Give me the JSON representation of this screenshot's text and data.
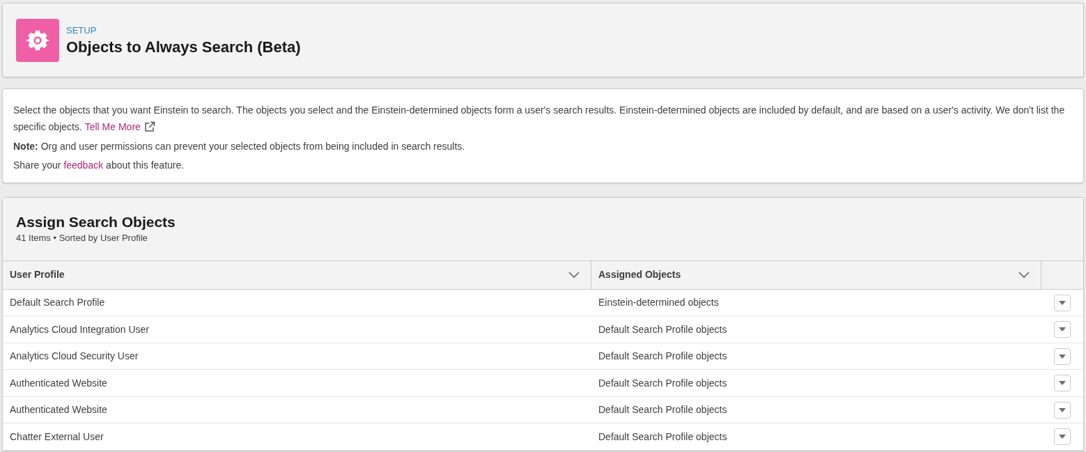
{
  "header": {
    "breadcrumb": "SETUP",
    "title": "Objects to Always Search (Beta)"
  },
  "description": {
    "intro": {
      "text": "Select the objects that you want Einstein to search. The objects you select and the Einstein-determined objects form a user's search results. Einstein-determined objects are included by default, and are based on a user's activity. We don't list the specific objects.",
      "link": "Tell Me More"
    },
    "note": "**Note:** Org and user permissions can prevent your selected objects from being included in search results.",
    "feedback": {
      "before": "Share your",
      "link": "feedback",
      "after": "about this feature."
    }
  },
  "table": {
    "title": "Assign Search Objects",
    "subtitle": "41 Items • Sorted by User Profile",
    "columns": [
      "User Profile",
      "Assigned Objects"
    ],
    "rows": [
      {
        "profile": "Default Search Profile",
        "objects": "Einstein-determined objects"
      },
      {
        "profile": "Analytics Cloud Integration User",
        "objects": "Default Search Profile objects"
      },
      {
        "profile": "Analytics Cloud Security User",
        "objects": "Default Search Profile objects"
      },
      {
        "profile": "Authenticated Website",
        "objects": "Default Search Profile objects"
      },
      {
        "profile": "Authenticated Website",
        "objects": "Default Search Profile objects"
      },
      {
        "profile": "Chatter External User",
        "objects": "Default Search Profile objects"
      }
    ]
  }
}
